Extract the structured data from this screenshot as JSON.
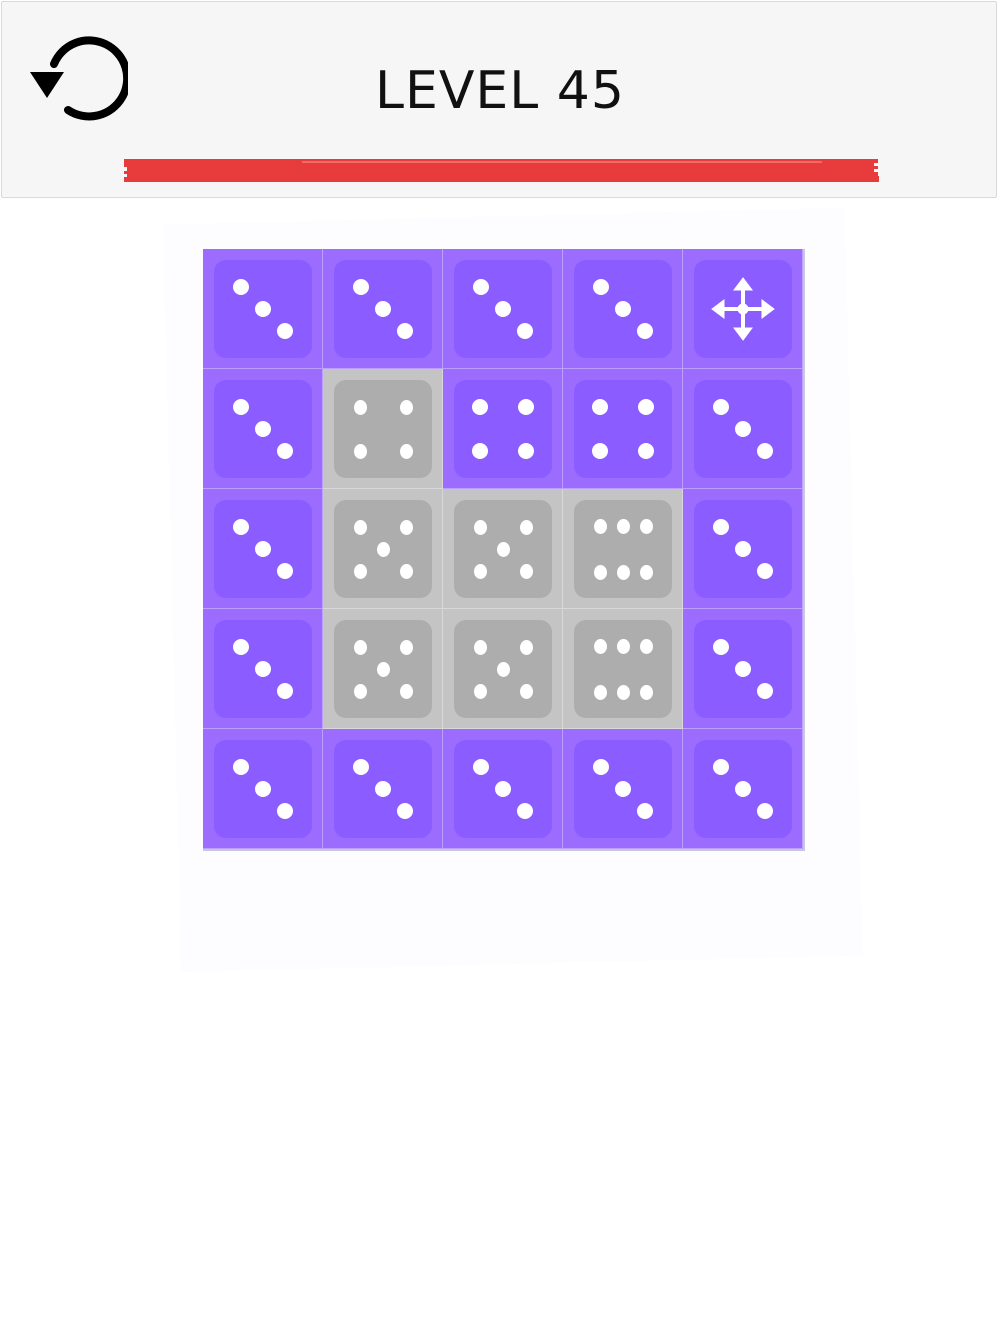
{
  "header": {
    "title": "LEVEL 45",
    "undo_icon": "undo-arrow-icon",
    "progress_color": "#e83b3b",
    "progress": 1.0
  },
  "board": {
    "rows": 5,
    "cols": 5,
    "colors": {
      "active_cell": "#9c6cff",
      "active_die": "#8b5cff",
      "inactive_cell": "#c4c4c4",
      "inactive_die": "#adadad",
      "pip": "#ffffff"
    },
    "cells": [
      [
        {
          "state": "active",
          "face": 3
        },
        {
          "state": "active",
          "face": 3
        },
        {
          "state": "active",
          "face": 3
        },
        {
          "state": "active",
          "face": 3
        },
        {
          "state": "active",
          "face": "move",
          "icon": "move-arrows-icon"
        }
      ],
      [
        {
          "state": "active",
          "face": 3
        },
        {
          "state": "inactive",
          "face": 4
        },
        {
          "state": "active",
          "face": 4
        },
        {
          "state": "active",
          "face": 4
        },
        {
          "state": "active",
          "face": 3
        }
      ],
      [
        {
          "state": "active",
          "face": 3
        },
        {
          "state": "inactive",
          "face": 5
        },
        {
          "state": "inactive",
          "face": 5
        },
        {
          "state": "inactive",
          "face": 6
        },
        {
          "state": "active",
          "face": 3
        }
      ],
      [
        {
          "state": "active",
          "face": 3
        },
        {
          "state": "inactive",
          "face": 5
        },
        {
          "state": "inactive",
          "face": 5
        },
        {
          "state": "inactive",
          "face": 6
        },
        {
          "state": "active",
          "face": 3
        }
      ],
      [
        {
          "state": "active",
          "face": 3
        },
        {
          "state": "active",
          "face": 3
        },
        {
          "state": "active",
          "face": 3
        },
        {
          "state": "active",
          "face": 3
        },
        {
          "state": "active",
          "face": 3
        }
      ]
    ]
  }
}
